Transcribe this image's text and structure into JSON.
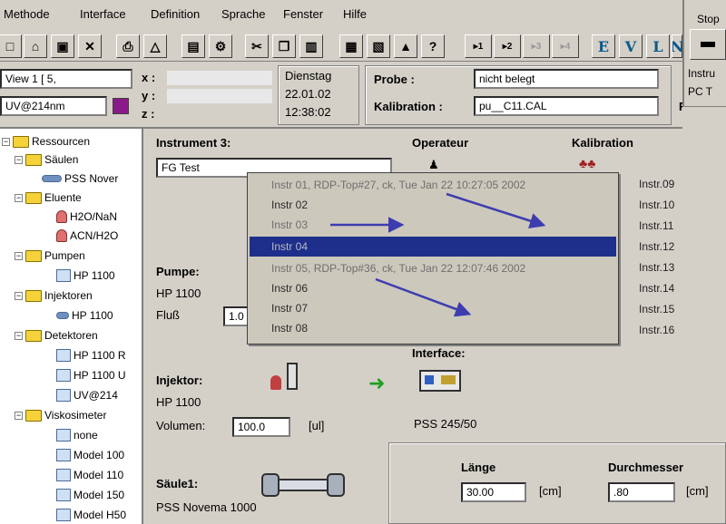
{
  "menu": [
    "Methode",
    "Interface",
    "Definition",
    "Sprache",
    "Fenster",
    "Hilfe"
  ],
  "toolbar": {
    "instrument_buttons": [
      "1",
      "2",
      "3",
      "4"
    ],
    "letter_buttons": [
      "E",
      "V",
      "L",
      "N"
    ]
  },
  "stop_panel": {
    "title": "Stop",
    "line1": "Instru",
    "line2": "PC T"
  },
  "status": {
    "view": "View 1 [ 5,",
    "detector": "UV@214nm",
    "x_label": "x :",
    "y_label": "y :",
    "z_label": "z :",
    "day": "Dienstag",
    "date": "22.01.02",
    "time": "12:38:02",
    "probe_label": "Probe :",
    "probe_value": "nicht belegt",
    "kalibration_label": "Kalibration :",
    "kalibration_value": "pu__C11.CAL",
    "fips_label": "Fips :"
  },
  "tree": {
    "root": "Ressourcen",
    "groups": [
      {
        "label": "Säulen",
        "children": [
          "PSS Nover"
        ]
      },
      {
        "label": "Eluente",
        "children": [
          "H2O/NaN",
          "ACN/H2O"
        ]
      },
      {
        "label": "Pumpen",
        "children": [
          "HP 1100"
        ]
      },
      {
        "label": "Injektoren",
        "children": [
          "HP 1100"
        ]
      },
      {
        "label": "Detektoren",
        "children": [
          "HP 1100 R",
          "HP 1100 U",
          "UV@214"
        ]
      },
      {
        "label": "Viskosimeter",
        "children": [
          "none",
          "Model 100",
          "Model 110",
          "Model 150",
          "Model H50"
        ]
      }
    ]
  },
  "main": {
    "instrument_label": "Instrument 3:",
    "instrument_value": "FG Test",
    "operateur_label": "Operateur",
    "kalibration_header": "Kalibration",
    "pumpe_label": "Pumpe:",
    "pumpe_value": "HP 1100",
    "fluss_label": "Fluß",
    "fluss_value": "1.0",
    "injektor_label": "Injektor:",
    "injektor_value": "HP 1100",
    "volumen_label": "Volumen:",
    "volumen_value": "100.0",
    "volumen_unit": "[ul]",
    "interface_label": "Interface:",
    "interface_value": "PSS 245/50",
    "laenge_label": "Länge",
    "laenge_value": "30.00",
    "laenge_unit": "[cm]",
    "durchmesser_label": "Durchmesser",
    "durchmesser_value": ".80",
    "durchmesser_unit": "[cm]",
    "saeule_label": "Säule1:",
    "saeule_value": "PSS Novema 1000"
  },
  "dropdown": {
    "items": [
      "Instr 01, RDP-Top#27, ck, Tue Jan 22 10:27:05 2002",
      "Instr 02",
      "Instr 03",
      "Instr 04",
      "Instr 05, RDP-Top#36, ck, Tue Jan 22 12:07:46 2002",
      "Instr 06",
      "Instr 07",
      "Instr 08"
    ],
    "selected_index": 3,
    "right_labels": [
      "Instr.09",
      "Instr.10",
      "Instr.11",
      "Instr.12",
      "Instr.13",
      "Instr.14",
      "Instr.15",
      "Instr.16"
    ]
  },
  "colors": {
    "selection": "#1d2f8a",
    "annotation_arrow": "#3d3db0"
  }
}
